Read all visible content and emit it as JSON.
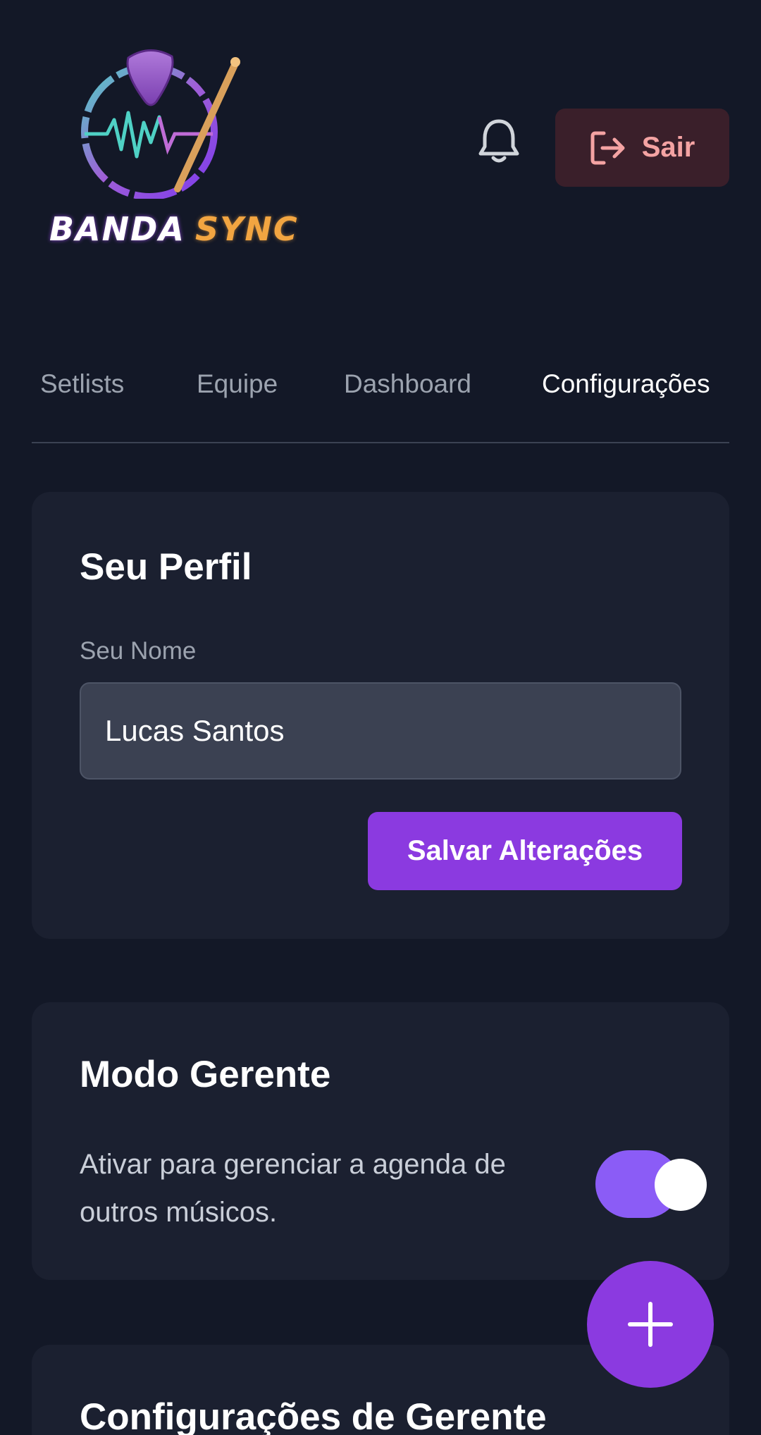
{
  "header": {
    "logo_word_1": "BANDA",
    "logo_word_2": "SYNC",
    "logout_label": "Sair",
    "bell_icon": "bell-icon",
    "logout_icon": "logout-icon"
  },
  "tabs": [
    {
      "label": "Setlists",
      "active": false
    },
    {
      "label": "Equipe",
      "active": false
    },
    {
      "label": "Dashboard",
      "active": false
    },
    {
      "label": "Configurações",
      "active": true
    }
  ],
  "profile": {
    "title": "Seu Perfil",
    "name_label": "Seu Nome",
    "name_value": "Lucas Santos",
    "save_label": "Salvar Alterações"
  },
  "manager": {
    "title": "Modo Gerente",
    "description": "Ativar para gerenciar a agenda de outros músicos.",
    "enabled": true
  },
  "manager_config": {
    "title": "Configurações de Gerente"
  },
  "fab": {
    "icon": "plus-icon"
  },
  "colors": {
    "background": "#131827",
    "card": "#1b2030",
    "accent": "#8b3ae0",
    "toggle_on": "#8b5cf6",
    "logout_bg": "#3a1f2a",
    "logout_text": "#f4a3a3"
  }
}
